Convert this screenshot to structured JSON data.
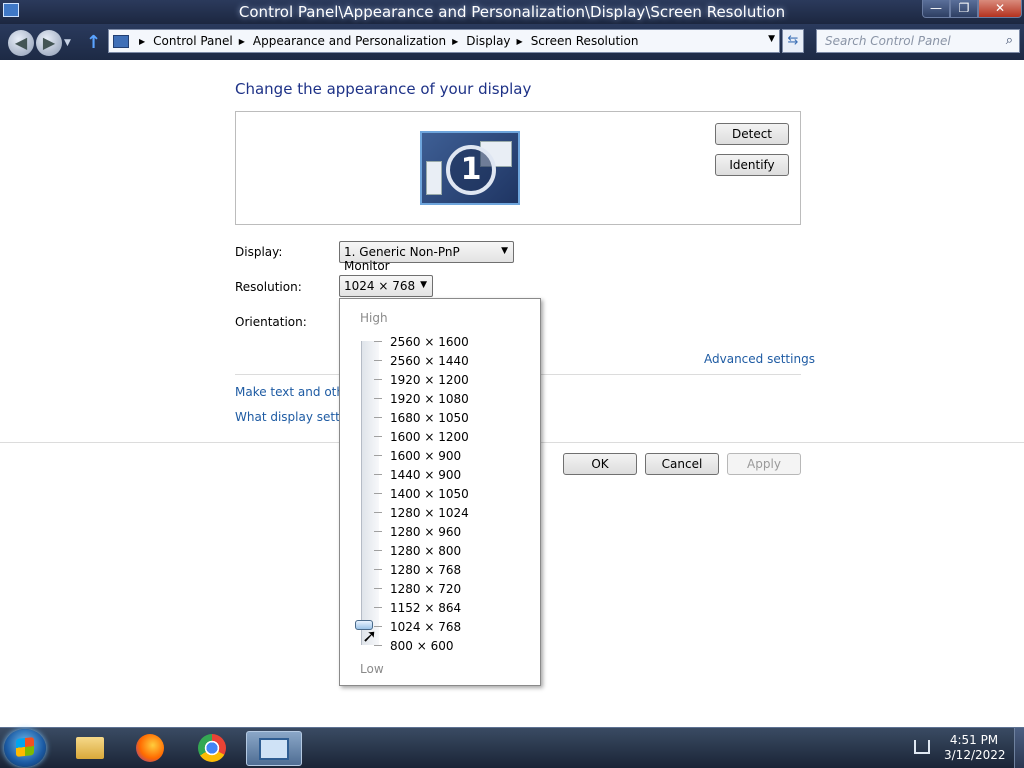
{
  "window": {
    "title": "Control Panel\\Appearance and Personalization\\Display\\Screen Resolution",
    "min": "—",
    "max": "❐",
    "close": "✕"
  },
  "address": {
    "crumbs": [
      "Control Panel",
      "Appearance and Personalization",
      "Display",
      "Screen Resolution"
    ],
    "search_placeholder": "Search Control Panel"
  },
  "main": {
    "heading": "Change the appearance of your display",
    "monitor_number": "1",
    "detect_label": "Detect",
    "identify_label": "Identify",
    "display_label": "Display:",
    "display_value": "1. Generic Non-PnP Monitor",
    "resolution_label": "Resolution:",
    "resolution_value": "1024 × 768",
    "orientation_label": "Orientation:",
    "advanced_link": "Advanced settings",
    "link_text_size": "Make text and other",
    "link_display_settings": "What display setting",
    "ok_label": "OK",
    "cancel_label": "Cancel",
    "apply_label": "Apply"
  },
  "dropdown": {
    "high_label": "High",
    "low_label": "Low",
    "selected": "1024 × 768",
    "resolutions": [
      "2560 × 1600",
      "2560 × 1440",
      "1920 × 1200",
      "1920 × 1080",
      "1680 × 1050",
      "1600 × 1200",
      "1600 × 900",
      "1440 × 900",
      "1400 × 1050",
      "1280 × 1024",
      "1280 × 960",
      "1280 × 800",
      "1280 × 768",
      "1280 × 720",
      "1152 × 864",
      "1024 × 768",
      "800 × 600"
    ]
  },
  "taskbar": {
    "time": "4:51 PM",
    "date": "3/12/2022"
  }
}
